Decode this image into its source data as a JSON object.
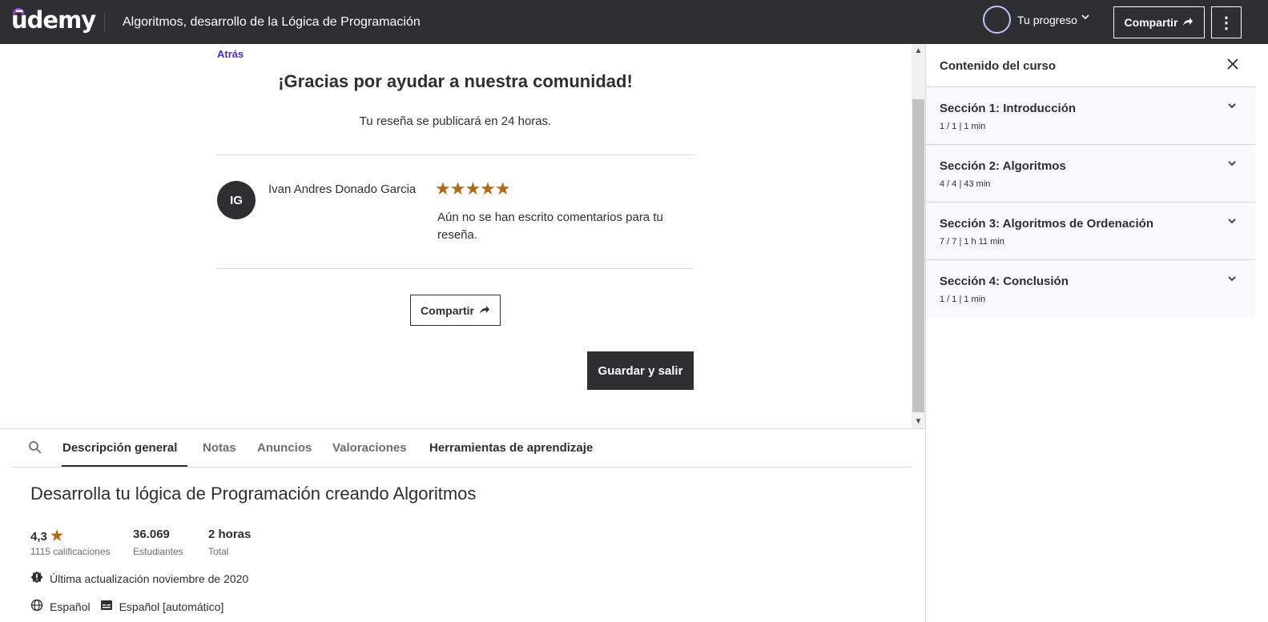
{
  "header": {
    "logo": "ūdemy",
    "course_title": "Algoritmos, desarrollo de la Lógica de Programación",
    "progress_label": "Tu progreso",
    "share_label": "Compartir",
    "more_label": "⋮"
  },
  "review": {
    "back_label": "Atrás",
    "thanks": "¡Gracias por ayudar a nuestra comunidad!",
    "publish_note": "Tu reseña se publicará en 24 horas.",
    "avatar_initials": "IG",
    "reviewer_name": "Ivan Andres Donado Garcia",
    "stars": "★★★★★",
    "rating_value": 5,
    "no_comments": "Aún no se han escrito comentarios para tu reseña.",
    "share_label": "Compartir",
    "save_exit_label": "Guardar y salir"
  },
  "tabs": [
    {
      "label": "Descripción general",
      "active": true
    },
    {
      "label": "Notas",
      "active": false
    },
    {
      "label": "Anuncios",
      "active": false
    },
    {
      "label": "Valoraciones",
      "active": false
    },
    {
      "label": "Herramientas de aprendizaje",
      "active": false
    }
  ],
  "overview": {
    "title": "Desarrolla tu lógica de Programación creando Algoritmos",
    "rating": "4,3",
    "rating_label": "1115 calificaciones",
    "students": "36.069",
    "students_label": "Estudiantes",
    "duration": "2 horas",
    "duration_label": "Total",
    "updated": "Última actualización noviembre de 2020",
    "language": "Español",
    "captions": "Español [automático]"
  },
  "sidebar": {
    "title": "Contenido del curso",
    "sections": [
      {
        "title": "Sección 1: Introducción",
        "meta": "1 / 1 | 1 min"
      },
      {
        "title": "Sección 2: Algoritmos",
        "meta": "4 / 4 | 43 min"
      },
      {
        "title": "Sección 3: Algoritmos de Ordenación",
        "meta": "7 / 7 | 1 h 11 min"
      },
      {
        "title": "Sección 4: Conclusión",
        "meta": "1 / 1 | 1 min"
      }
    ]
  },
  "colors": {
    "header_bg": "#2d2f31",
    "accent": "#5624d0",
    "star": "#b4690e"
  }
}
